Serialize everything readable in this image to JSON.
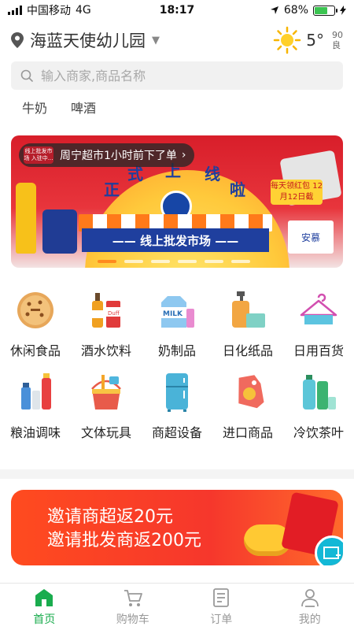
{
  "status_bar": {
    "carrier": "中国移动",
    "network": "4G",
    "time": "18:17",
    "battery_percent": "68%",
    "battery_level": 0.68
  },
  "header": {
    "location": "海蓝天使幼儿园",
    "weather": {
      "temperature": "5°",
      "aqi_value": "90",
      "aqi_level": "良",
      "icon": "sun-icon"
    }
  },
  "search": {
    "placeholder": "输入商家,商品名称"
  },
  "hot_tags": [
    "牛奶",
    "啤酒"
  ],
  "banner": {
    "notice_badge": "线上批发市场 入驻中...",
    "notice_text": "周宁超市1小时前下了单",
    "notice_arrow": "›",
    "headline_chars": [
      "正",
      "式",
      "上",
      "线",
      "啦"
    ],
    "strip_text": "—— 线上批发市场 ——",
    "red_packet": "每天领红包 12月12日截",
    "box_text": "安慕",
    "slides": 6,
    "active_slide": 1,
    "colors": {
      "accent": "#ff8a1e",
      "strip": "#1f3f9e"
    }
  },
  "categories": [
    {
      "label": "休闲食品",
      "icon": "cookie-icon"
    },
    {
      "label": "酒水饮料",
      "icon": "drink-bottles-icon"
    },
    {
      "label": "奶制品",
      "icon": "milk-carton-icon"
    },
    {
      "label": "日化纸品",
      "icon": "soap-tissue-icon"
    },
    {
      "label": "日用百货",
      "icon": "hanger-icon"
    },
    {
      "label": "粮油调味",
      "icon": "oil-condiment-icon"
    },
    {
      "label": "文体玩具",
      "icon": "sand-bucket-icon"
    },
    {
      "label": "商超设备",
      "icon": "fridge-icon"
    },
    {
      "label": "进口商品",
      "icon": "price-tag-icon"
    },
    {
      "label": "冷饮茶叶",
      "icon": "water-bottle-icon"
    }
  ],
  "invite": {
    "line1": "邀请商超返20元",
    "line2": "邀请批发商返200元"
  },
  "tabbar": {
    "items": [
      {
        "label": "首页",
        "icon": "home-icon",
        "active": true
      },
      {
        "label": "购物车",
        "icon": "cart-icon",
        "active": false
      },
      {
        "label": "订单",
        "icon": "order-list-icon",
        "active": false
      },
      {
        "label": "我的",
        "icon": "user-icon",
        "active": false
      }
    ],
    "colors": {
      "active": "#1aac4e",
      "inactive": "#999999"
    }
  }
}
